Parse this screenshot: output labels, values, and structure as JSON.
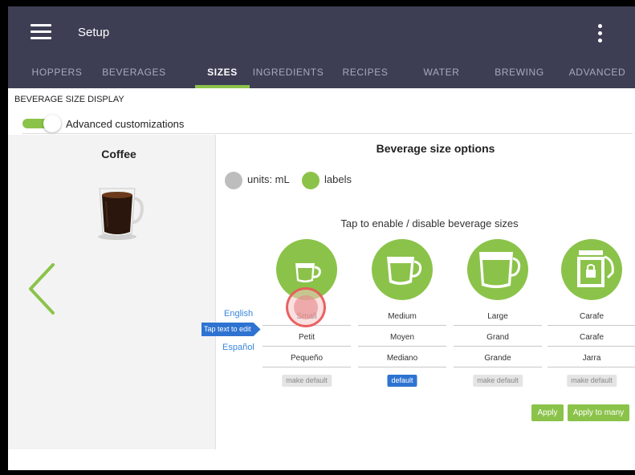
{
  "header": {
    "title": "Setup",
    "menu_icon": "hamburger-menu-icon",
    "more_icon": "vertical-dots-icon"
  },
  "tabs": [
    {
      "label": "HOPPERS",
      "active": false
    },
    {
      "label": "BEVERAGES",
      "active": false
    },
    {
      "label": "SIZES",
      "active": true
    },
    {
      "label": "INGREDIENTS",
      "active": false
    },
    {
      "label": "RECIPES",
      "active": false
    },
    {
      "label": "WATER",
      "active": false
    },
    {
      "label": "BREWING",
      "active": false
    },
    {
      "label": "ADVANCED",
      "active": false
    }
  ],
  "section": {
    "title": "BEVERAGE SIZE DISPLAY",
    "toggle_label": "Advanced customizations",
    "toggle_on": true
  },
  "beverage": {
    "name": "Coffee",
    "image_icon": "coffee-cup-icon"
  },
  "options": {
    "title": "Beverage size options",
    "units_label": "units: mL",
    "labels_label": "labels",
    "selected_mode": "labels",
    "instruction": "Tap to enable / disable beverage sizes",
    "tap_hint": "Tap text to edit"
  },
  "languages": {
    "english": "English",
    "espanol": "Español"
  },
  "sizes": [
    {
      "icon": "small-cup-icon",
      "english": "Small",
      "french": "Petit",
      "spanish": "Pequeño",
      "default_label": "make default",
      "is_default": false
    },
    {
      "icon": "medium-cup-icon",
      "english": "Medium",
      "french": "Moyen",
      "spanish": "Mediano",
      "default_label": "default",
      "is_default": true
    },
    {
      "icon": "large-cup-icon",
      "english": "Large",
      "french": "Grand",
      "spanish": "Grande",
      "default_label": "make default",
      "is_default": false
    },
    {
      "icon": "carafe-icon",
      "english": "Carafe",
      "french": "Carafe",
      "spanish": "Jarra",
      "default_label": "make default",
      "is_default": false
    }
  ],
  "actions": {
    "apply": "Apply",
    "apply_many": "Apply to many"
  },
  "colors": {
    "accent": "#8bc34a",
    "header": "#3d3e54",
    "link": "#3a86d8",
    "selected": "#2e73d1"
  }
}
